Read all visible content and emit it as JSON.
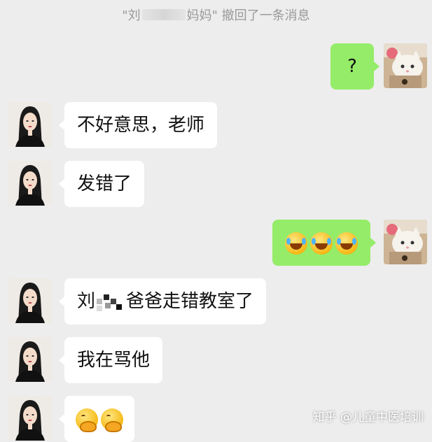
{
  "system_message": {
    "prefix": "\"刘",
    "suffix": "妈妈\" 撤回了一条消息"
  },
  "messages": [
    {
      "side": "out",
      "text": "?"
    },
    {
      "side": "in",
      "text": "不好意思，老师"
    },
    {
      "side": "in",
      "text": "发错了"
    },
    {
      "side": "out",
      "emoji": [
        "laughing-crying-emoji",
        "laughing-crying-emoji",
        "laughing-crying-emoji"
      ]
    },
    {
      "side": "in",
      "text_before": "刘",
      "text_after": "爸爸走错教室了"
    },
    {
      "side": "in",
      "text": "我在骂他"
    },
    {
      "side": "in",
      "emoji": [
        "shy-smile-emoji",
        "shy-smile-emoji"
      ]
    }
  ],
  "watermark": "知乎 @儿童中医培训",
  "colors": {
    "background": "#ededed",
    "incoming_bubble": "#ffffff",
    "outgoing_bubble": "#95ec69"
  }
}
